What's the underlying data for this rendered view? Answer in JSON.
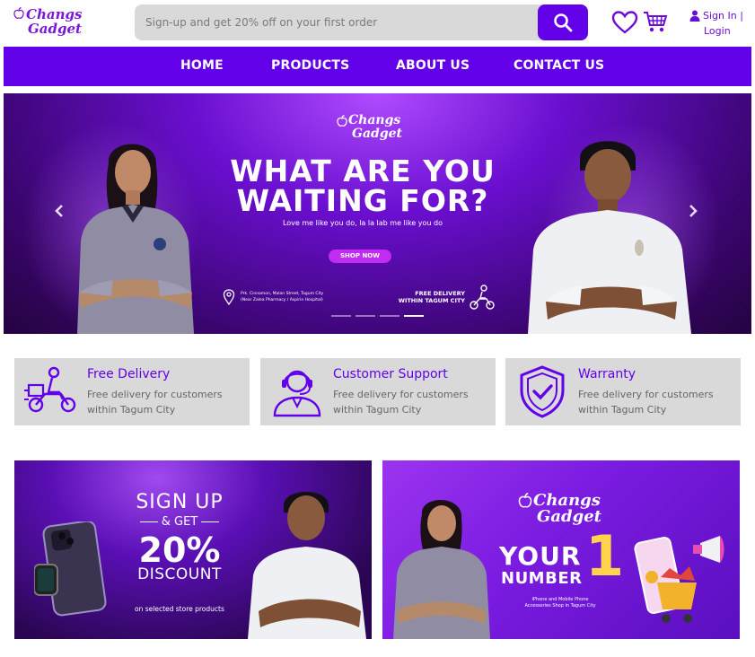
{
  "brand": {
    "line1": "Changs",
    "line2": "Gadget",
    "accent": "#6200ea"
  },
  "search": {
    "placeholder": "Sign-up and get 20% off on your first order"
  },
  "account": {
    "signin": "Sign In |",
    "login": "Login"
  },
  "nav": {
    "items": [
      "HOME",
      "PRODUCTS",
      "ABOUT US",
      "CONTACT US"
    ]
  },
  "hero": {
    "title_line1": "WHAT ARE YOU",
    "title_line2": "WAITING FOR?",
    "subtitle": "Love me like you do, la la lab me like you do",
    "cta": "SHOP NOW",
    "address_line1": "Prk. Cinnamon, Malan Street, Tagum City",
    "address_line2": "(Near Zalea Pharmacy / Aspirin Hospital)",
    "delivery_line1": "FREE DELIVERY",
    "delivery_line2": "WITHIN TAGUM CITY",
    "prev_icon": "chevron-left-icon",
    "next_icon": "chevron-right-icon",
    "active_slide": 4,
    "slide_count": 4
  },
  "features": [
    {
      "title": "Free Delivery",
      "desc": "Free delivery for customers within Tagum City",
      "icon": "delivery-scooter-icon"
    },
    {
      "title": "Customer Support",
      "desc": "Free delivery for customers within Tagum City",
      "icon": "headset-agent-icon"
    },
    {
      "title": "Warranty",
      "desc": "Free delivery for customers within Tagum City",
      "icon": "shield-check-icon"
    }
  ],
  "promo_left": {
    "line1": "SIGN UP",
    "line2": "& GET",
    "line3": "20%",
    "line4": "DISCOUNT",
    "note": "on selected store products"
  },
  "promo_right": {
    "line1": "YOUR",
    "line2": "NUMBER",
    "number": "1",
    "note_line1": "iPhone and Mobile Phone",
    "note_line2": "Accessories Shop in Tagum City"
  }
}
